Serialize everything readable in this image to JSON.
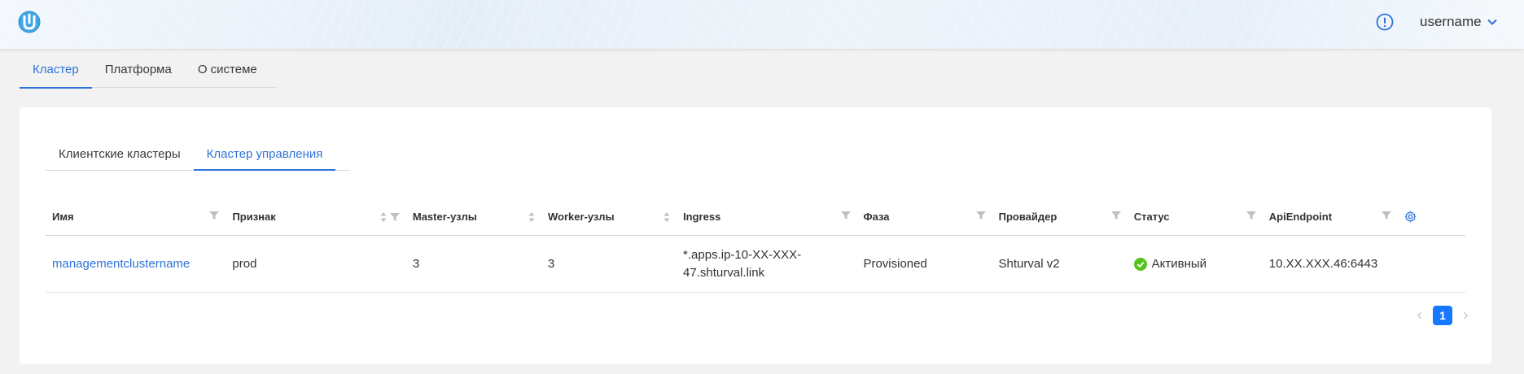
{
  "header": {
    "logo_icon": "shturval-logo-icon",
    "alert_icon": "alert-circle-icon",
    "username": "username",
    "accent": "#2f73d8"
  },
  "top_tabs": [
    {
      "label": "Кластер",
      "active": true
    },
    {
      "label": "Платформа",
      "active": false
    },
    {
      "label": "О системе",
      "active": false
    }
  ],
  "inner_tabs": [
    {
      "label": "Клиентские кластеры",
      "active": false
    },
    {
      "label": "Кластер управления",
      "active": true
    }
  ],
  "table": {
    "columns": [
      {
        "label": "Имя"
      },
      {
        "label": "Признак"
      },
      {
        "label": "Master-узлы"
      },
      {
        "label": "Worker-узлы"
      },
      {
        "label": "Ingress"
      },
      {
        "label": "Фаза"
      },
      {
        "label": "Провайдер"
      },
      {
        "label": "Статус"
      },
      {
        "label": "ApiEndpoint"
      }
    ],
    "rows": [
      {
        "name": "managementclustername",
        "sign": "prod",
        "master": "3",
        "worker": "3",
        "ingress_line1": "*.apps.ip-10-XX-XXX-",
        "ingress_line2": "47.shturval.link",
        "phase": "Provisioned",
        "provider": "Shturval v2",
        "status": "Активный",
        "status_color": "#52c41a",
        "api_endpoint": "10.XX.XXX.46:6443"
      }
    ]
  },
  "pagination": {
    "current_page": "1",
    "prev_disabled": true,
    "next_disabled": true
  }
}
